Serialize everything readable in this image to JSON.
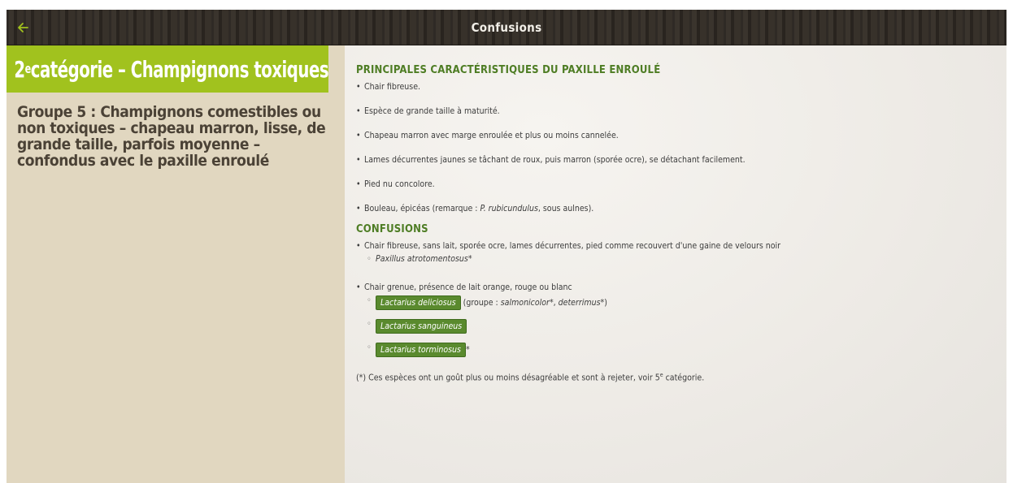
{
  "header": {
    "title": "Confusions",
    "back_icon": "arrow-left-icon",
    "accent": "#a1c21e"
  },
  "sidebar": {
    "category_prefix": "2",
    "category_sup": "e",
    "category_suffix": " catégorie – Champignons toxiques",
    "group_text": "Groupe 5 : Champignons comestibles ou non toxiques – chapeau marron, lisse, de grande taille, parfois moyenne – confondus avec le paxille enroulé"
  },
  "content": {
    "characteristics_title": "PRINCIPALES CARACTÉRISTIQUES DU PAXILLE ENROULÉ",
    "characteristics": [
      "Chair fibreuse.",
      "Espèce de grande taille à maturité.",
      "Chapeau marron avec marge enroulée et plus ou moins cannelée.",
      "Lames décurrentes jaunes se tâchant de roux, puis marron (sporée ocre), se détachant facilement.",
      "Pied nu concolore."
    ],
    "habitat_before": "Bouleau, épicéas (remarque : ",
    "habitat_species": "P. rubicundulus",
    "habitat_after": ", sous aulnes).",
    "confusions_title": "CONFUSIONS",
    "confusion1_text": "Chair fibreuse, sans lait, sporée ocre, lames décurrentes, pied comme recouvert d'une gaine de velours noir",
    "confusion1_species": "Paxillus atrotomentosus",
    "confusion1_star": "*",
    "confusion2_text": "Chair grenue, présence de lait orange, rouge ou blanc",
    "species": [
      {
        "name": "Lactarius deliciosus",
        "suffix": ""
      },
      {
        "name": "Lactarius sanguineus",
        "suffix": ""
      },
      {
        "name": "Lactarius torminosus",
        "suffix": "*"
      }
    ],
    "deliciosus_group_before": "(groupe : ",
    "deliciosus_group_1": "salmonicolor",
    "deliciosus_group_mid": "*, ",
    "deliciosus_group_2": "deterrimus",
    "deliciosus_group_after": "*)",
    "footnote_before": "(*) Ces espèces ont un goût plus ou moins désagréable et sont à rejeter, voir 5",
    "footnote_sup": "e",
    "footnote_after": " catégorie."
  }
}
